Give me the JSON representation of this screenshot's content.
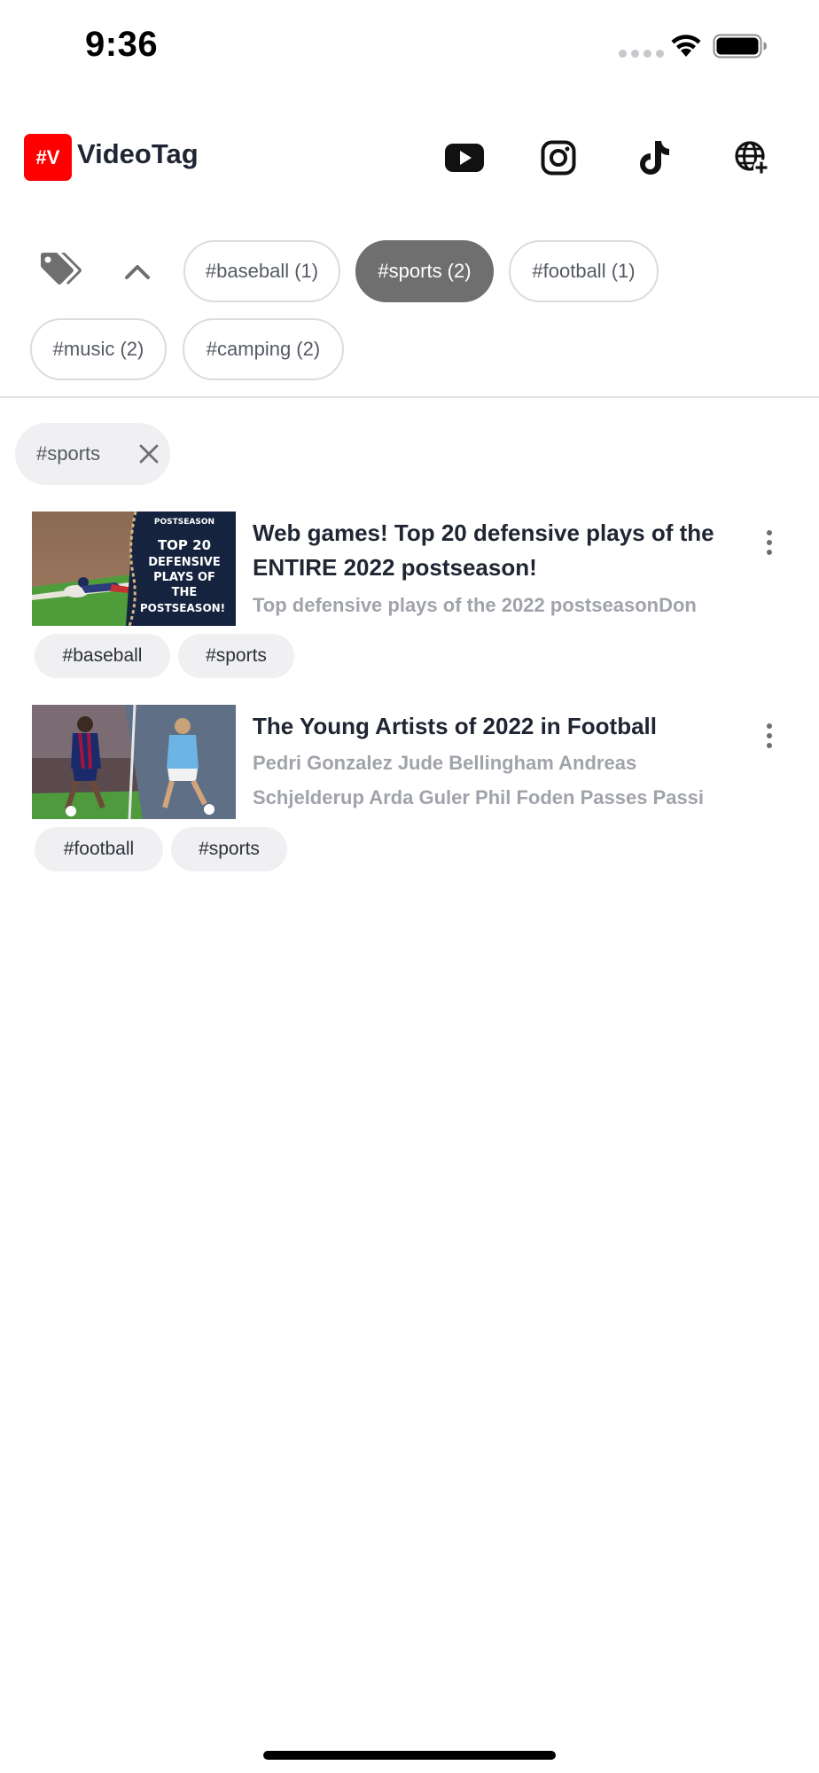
{
  "status_bar": {
    "time": "9:36"
  },
  "header": {
    "logo_text": "#V",
    "app_title": "VideoTag",
    "icons": [
      "youtube-icon",
      "instagram-icon",
      "tiktok-icon",
      "globe-add-icon"
    ],
    "brand_color": "#ff0000"
  },
  "tag_filters": [
    {
      "label": "#baseball (1)",
      "selected": false
    },
    {
      "label": "#sports (2)",
      "selected": true
    },
    {
      "label": "#football (1)",
      "selected": false
    },
    {
      "label": "#music (2)",
      "selected": false
    },
    {
      "label": "#camping (2)",
      "selected": false
    }
  ],
  "active_filter": {
    "label": "#sports"
  },
  "videos": [
    {
      "thumbnail_text": [
        "POSTSEASON",
        "TOP 20",
        "DEFENSIVE",
        "PLAYS OF",
        "THE",
        "POSTSEASON!"
      ],
      "title": "Web games! Top 20 defensive plays of the ENTIRE 2022 postseason!",
      "description": "Top defensive plays of the 2022 postseasonDon",
      "tags": [
        "#baseball",
        "#sports"
      ]
    },
    {
      "title": "The Young Artists of 2022 in Football",
      "description_line1": "Pedri Gonzalez Jude Bellingham Andreas",
      "description_line2": "Schjelderup Arda Guler Phil Foden Passes Passi",
      "tags": [
        "#football",
        "#sports"
      ]
    }
  ],
  "colors": {
    "selected_chip": "#6f6f6f",
    "text_primary": "#1f2532",
    "text_muted": "#a0a3aa"
  }
}
